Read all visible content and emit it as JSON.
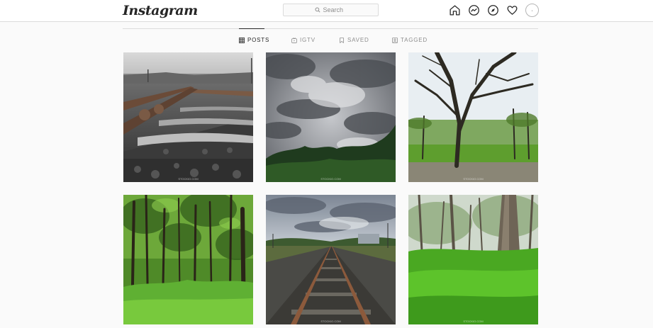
{
  "header": {
    "logo_text": "Instagram",
    "search": {
      "placeholder": "Search"
    },
    "nav_icons": [
      "home-icon",
      "messenger-icon",
      "explore-icon",
      "heart-icon",
      "avatar"
    ]
  },
  "tabs": [
    {
      "label": "POSTS",
      "icon": "grid-icon",
      "active": true
    },
    {
      "label": "IGTV",
      "icon": "igtv-icon",
      "active": false
    },
    {
      "label": "SAVED",
      "icon": "bookmark-icon",
      "active": false
    },
    {
      "label": "TAGGED",
      "icon": "tag-icon",
      "active": false
    }
  ],
  "posts": [
    {
      "subject": "railway tracks close-up, black and white with rust",
      "watermark": "STOCKIO.COM"
    },
    {
      "subject": "storm clouds over treeline",
      "watermark": "STOCKIO.COM"
    },
    {
      "subject": "bare tree in green park",
      "watermark": "STOCKIO.COM"
    },
    {
      "subject": "dense green forest",
      "watermark": ""
    },
    {
      "subject": "railway tracks under cloudy sky",
      "watermark": "STOCKIO.COM"
    },
    {
      "subject": "forest with tall green grass",
      "watermark": "STOCKIO.COM"
    }
  ],
  "colors": {
    "background": "#fafafa",
    "header_bg": "#ffffff",
    "border": "#dbdbdb",
    "text_primary": "#262626",
    "text_secondary": "#8e8e8e"
  }
}
